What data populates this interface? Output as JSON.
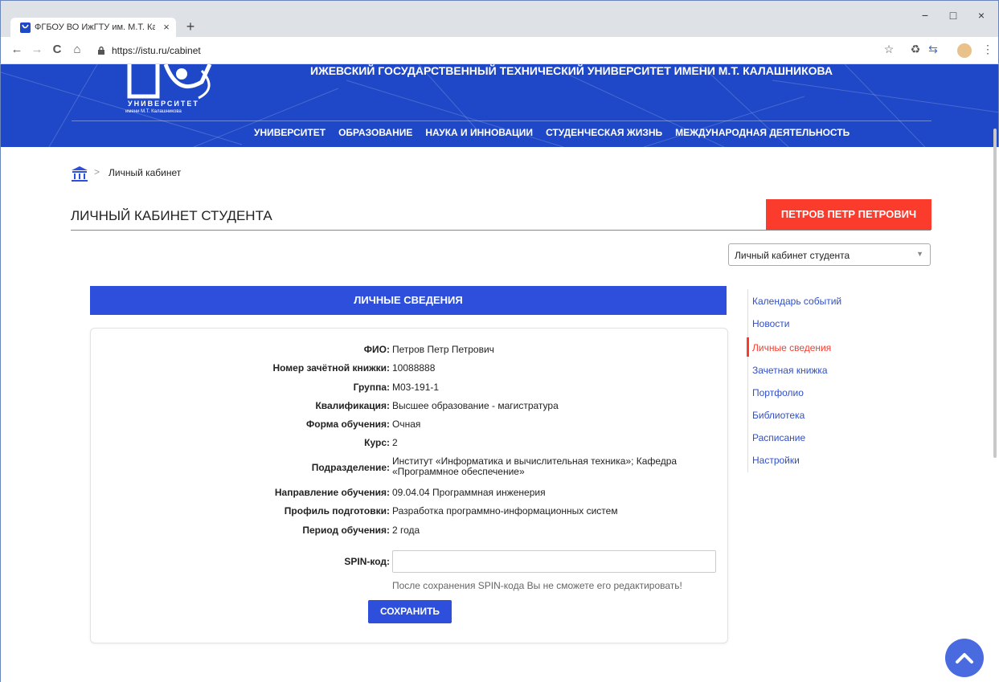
{
  "browser": {
    "tab_title": "ФГБОУ ВО ИжГТУ им. М.Т. Калашникова",
    "tab_close": "×",
    "new_tab": "+",
    "url": "https://istu.ru/cabinet",
    "window_controls": {
      "minimize": "−",
      "maximize": "□",
      "close": "×"
    },
    "nav": {
      "back": "←",
      "forward": "→",
      "reload": "C",
      "home": "⌂"
    },
    "tools": {
      "star": "☆",
      "recycle": "♻",
      "translate": "⇆",
      "menu": "⋮"
    }
  },
  "header": {
    "logo_text": "УНИВЕРСИТЕТ",
    "logo_subtext": "имени М.Т. Калашникова",
    "university_title": "ИЖЕВСКИЙ ГОСУДАРСТВЕННЫЙ ТЕХНИЧЕСКИЙ УНИВЕРСИТЕТ ИМЕНИ М.Т. КАЛАШНИКОВА",
    "nav_items": [
      "УНИВЕРСИТЕТ",
      "ОБРАЗОВАНИЕ",
      "НАУКА И ИННОВАЦИИ",
      "СТУДЕНЧЕСКАЯ ЖИЗНЬ",
      "МЕЖДУНАРОДНАЯ ДЕЯТЕЛЬНОСТЬ"
    ]
  },
  "breadcrumb": {
    "separator": ">",
    "current": "Личный кабинет"
  },
  "page": {
    "title": "ЛИЧНЫЙ КАБИНЕТ СТУДЕНТА",
    "user_name": "ПЕТРОВ ПЕТР ПЕТРОВИЧ",
    "cabinet_select": "Личный кабинет студента",
    "cabinet_caret": "▼"
  },
  "section": {
    "title": "ЛИЧНЫЕ СВЕДЕНИЯ"
  },
  "info": {
    "fio_label": "ФИО:",
    "fio": "Петров Петр Петрович",
    "record_label": "Номер зачётной книжки:",
    "record": "10088888",
    "group_label": "Группа:",
    "group": "М03-191-1",
    "qual_label": "Квалификация:",
    "qual": "Высшее образование - магистратура",
    "form_label": "Форма обучения:",
    "form": "Очная",
    "course_label": "Курс:",
    "course": "2",
    "dept_label": "Подразделение:",
    "dept": "Институт «Информатика и вычислительная техника»; Кафедра «Программное обеспечение»",
    "direction_label": "Направление обучения:",
    "direction": "09.04.04 Программная инженерия",
    "profile_label": "Профиль подготовки:",
    "profile": "Разработка программно-информационных систем",
    "period_label": "Период обучения:",
    "period": "2 года",
    "spin_label": "SPIN-код:",
    "spin_value": "",
    "spin_hint": "После сохранения SPIN-кода Вы не сможете его редактировать!",
    "save_label": "СОХРАНИТЬ"
  },
  "side_menu": {
    "items": [
      "Календарь событий",
      "Новости",
      "Личные сведения",
      "Зачетная книжка",
      "Портфолио",
      "Библиотека",
      "Расписание",
      "Настройки"
    ],
    "active": "Личные сведения"
  },
  "colors": {
    "brand_blue": "#1f48c8",
    "accent_red": "#fb3b2b",
    "link_blue": "#2f4fc9"
  }
}
